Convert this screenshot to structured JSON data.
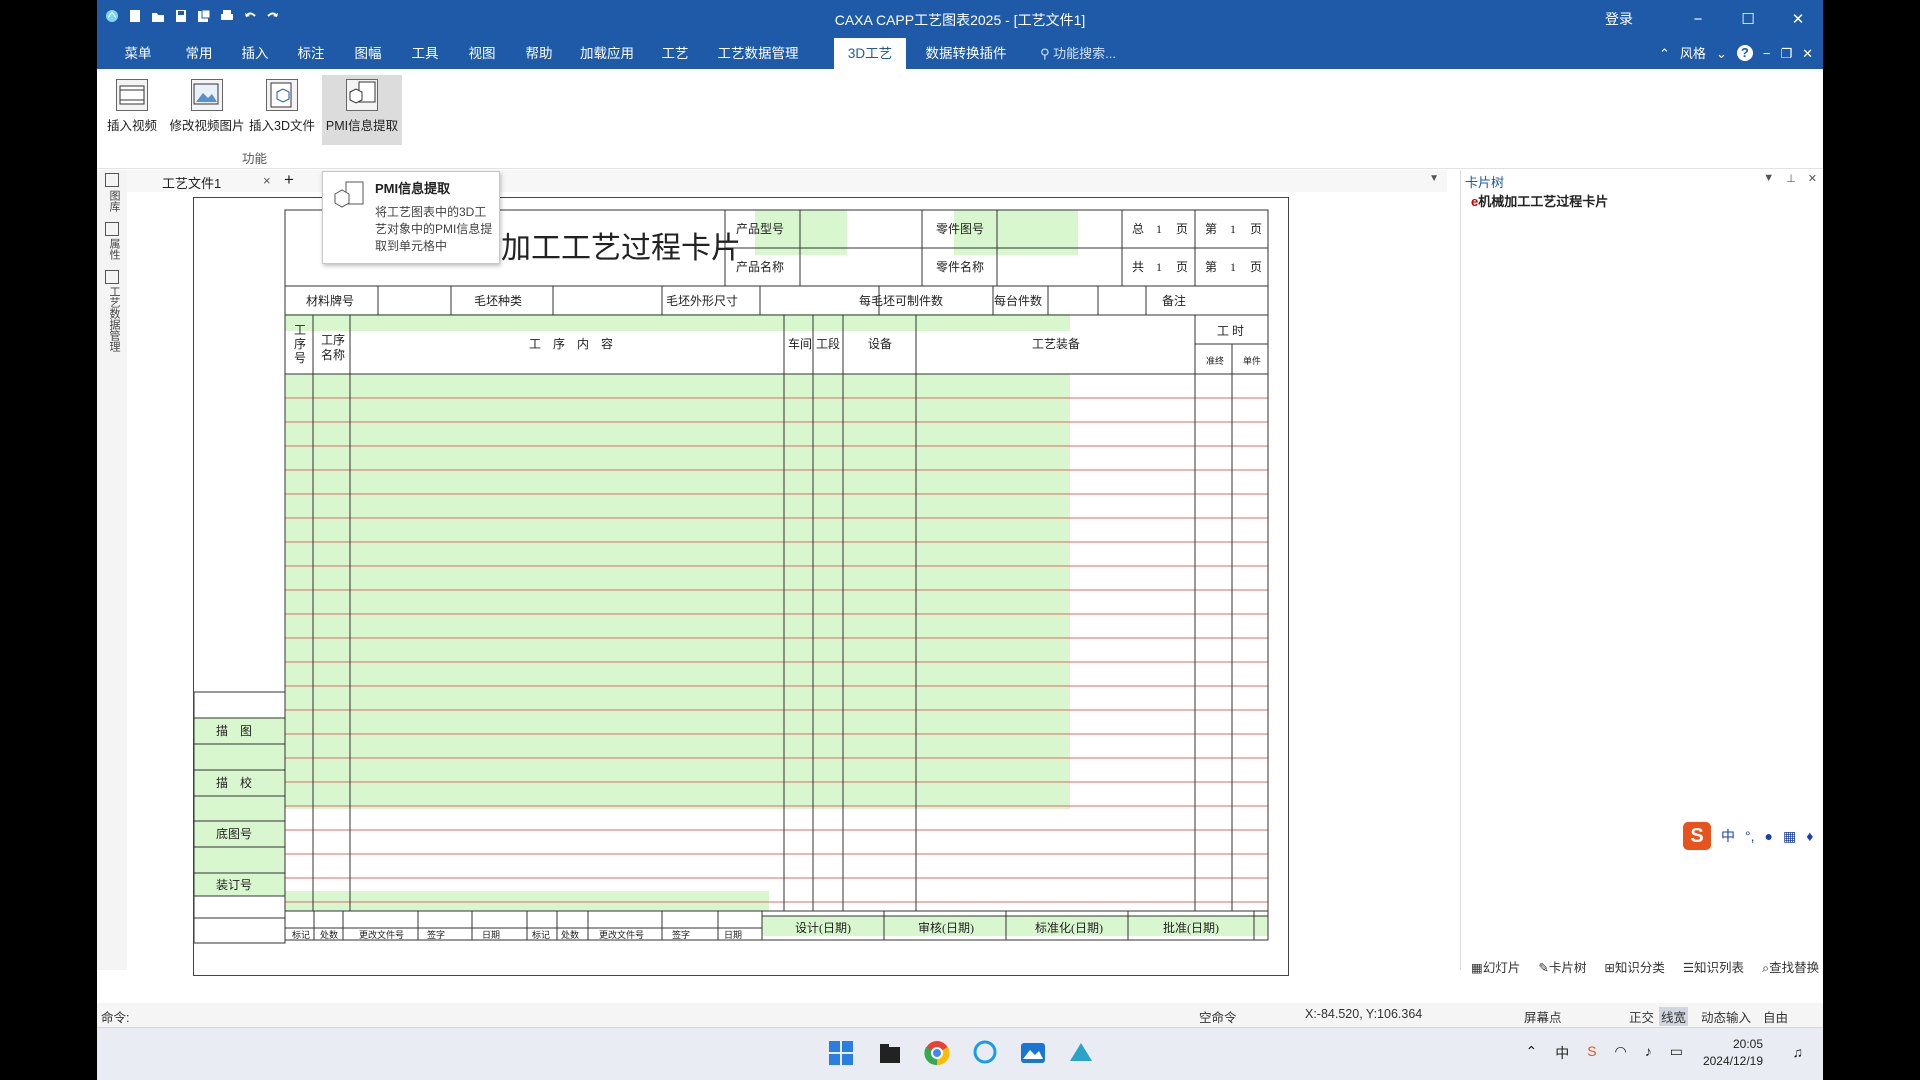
{
  "app": {
    "title": "CAXA CAPP工艺图表2025 - [工艺文件1]",
    "login": "登录",
    "win_min": "−",
    "win_max": "☐",
    "win_close": "✕"
  },
  "menu": {
    "tabs": [
      "菜单",
      "常用",
      "插入",
      "标注",
      "图幅",
      "工具",
      "视图",
      "帮助",
      "加载应用",
      "工艺",
      "工艺数据管理",
      "3D工艺",
      "数据转换插件"
    ],
    "active": "3D工艺",
    "search_placeholder": "功能搜索...",
    "style_label": "风格",
    "help": "?"
  },
  "ribbon": {
    "buttons": [
      "插入视频",
      "修改视频图片",
      "插入3D文件",
      "PMI信息提取"
    ],
    "group_label": "功能"
  },
  "tooltip": {
    "title": "PMI信息提取",
    "desc": "将工艺图表中的3D工艺对象中的PMI信息提取到单元格中"
  },
  "left_strip": {
    "labels": [
      "图库",
      "属性",
      "工艺数据管理"
    ]
  },
  "doc_tab": {
    "name": "工艺文件1",
    "close": "×",
    "add": "+"
  },
  "card": {
    "title": "加工工艺过程卡片",
    "header": {
      "product_model": "产品型号",
      "product_name": "产品名称",
      "part_number": "零件图号",
      "part_name": "零件名称",
      "total": "总",
      "pages1": "1",
      "page_unit": "页",
      "nth": "第",
      "gong": "共"
    },
    "row2": [
      "材料牌号",
      "毛坯种类",
      "毛坯外形尺寸",
      "每毛坯可制件数",
      "每台件数",
      "备注"
    ],
    "columns": {
      "op_no": "工序号",
      "op_name": "工序名称",
      "op_content": "工　序　内　容",
      "workshop": "车间",
      "section": "工段",
      "equipment": "设备",
      "tooling": "工艺装备",
      "hours": "工 时",
      "prep": "准终",
      "unit": "单件"
    },
    "side_labels": [
      "描　图",
      "描　校",
      "底图号",
      "装订号"
    ],
    "bottom_headers": [
      "标记",
      "处数",
      "更改文件号",
      "签字",
      "日期",
      "标记",
      "处数",
      "更改文件号",
      "签字",
      "日期"
    ],
    "sign_headers": [
      "设计(日期)",
      "审核(日期)",
      "标准化(日期)",
      "批准(日期)"
    ]
  },
  "right_panel": {
    "title": "卡片树",
    "root_node": "机械加工工艺过程卡片",
    "bottom_tabs": [
      "幻灯片",
      "卡片树",
      "知识分类",
      "知识列表",
      "查找替换"
    ],
    "ime_chinese": "中"
  },
  "status": {
    "command_label": "命令:",
    "idle": "空命令",
    "coords": "X:-84.520, Y:106.364",
    "snap": "屏幕点",
    "ortho": "正交",
    "linewidth": "线宽",
    "dynamic": "动态输入",
    "free": "自由"
  },
  "taskbar": {
    "time": "20:05",
    "date": "2024/12/19"
  },
  "colors": {
    "brand": "#1e5aa8",
    "grid_fill": "#d9f7cf",
    "grid_line": "#e06a6a"
  }
}
